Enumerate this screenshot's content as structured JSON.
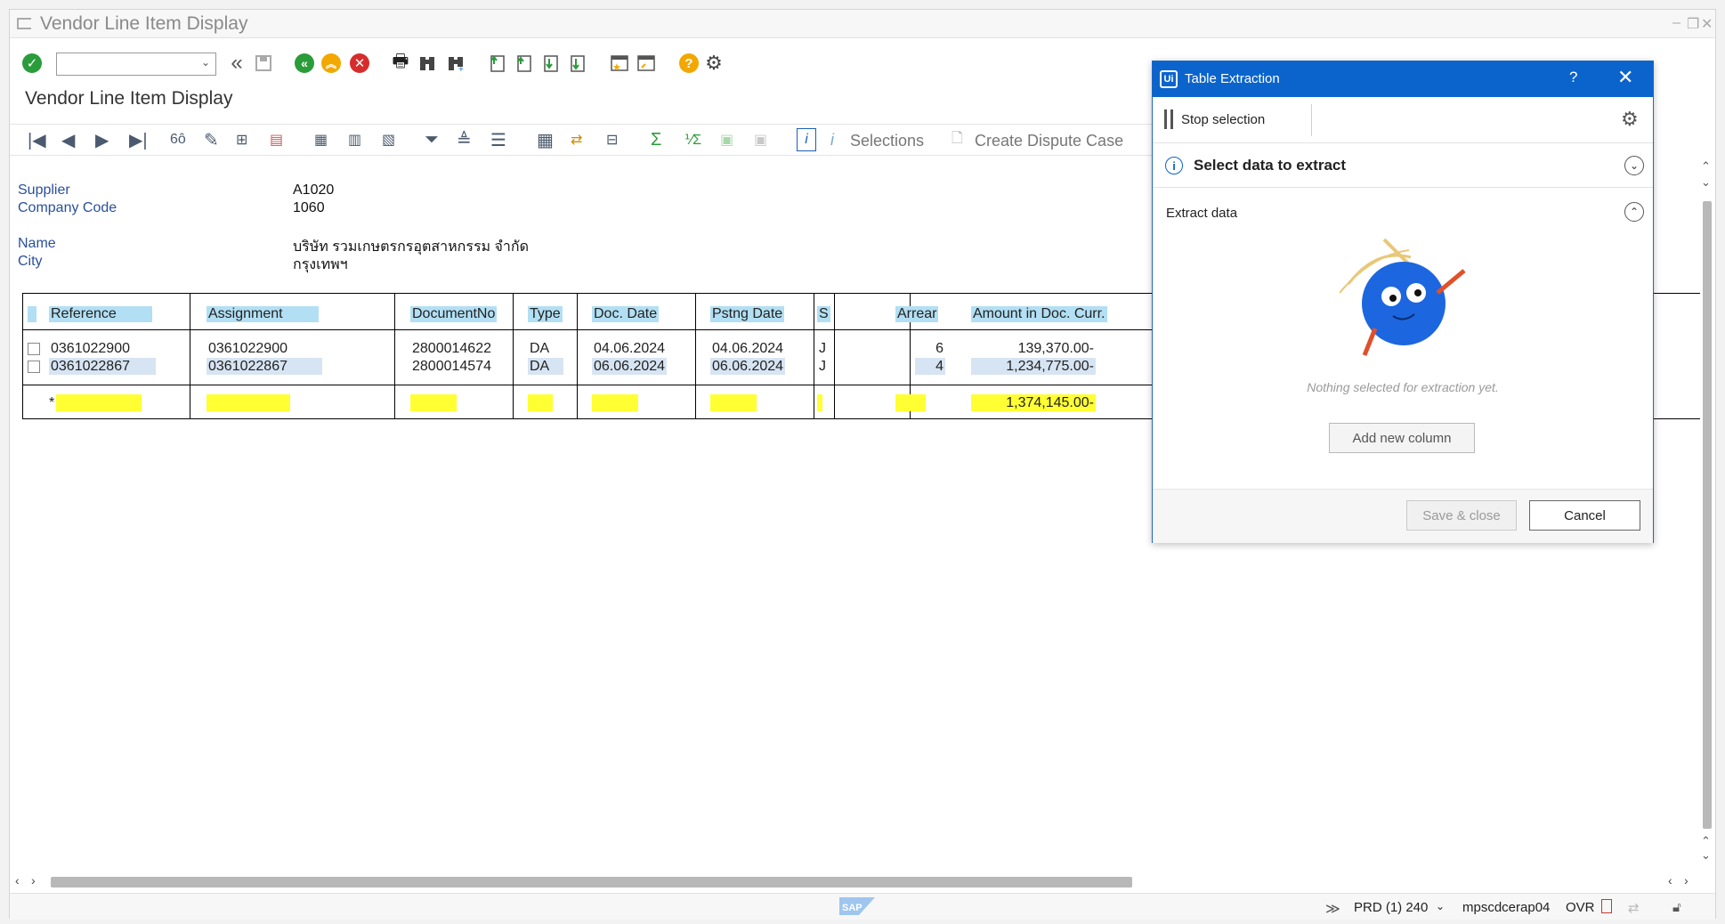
{
  "window": {
    "title": "Vendor Line Item Display"
  },
  "app_title": "Vendor Line Item Display",
  "toolbar2": {
    "selections_label": "Selections",
    "dispute_label": "Create Dispute Case"
  },
  "header_fields": [
    {
      "label": "Supplier",
      "value": "A1020"
    },
    {
      "label": "Company Code",
      "value": "1060"
    },
    {
      "label": "Name",
      "value": "บริษัท รวมเกษตรกรอุตสาหกรรม จำกัด"
    },
    {
      "label": "City",
      "value": "กรุงเทพฯ"
    }
  ],
  "table": {
    "columns": [
      "Reference",
      "Assignment",
      "DocumentNo",
      "Type",
      "Doc. Date",
      "Pstng Date",
      "S",
      "Arrear",
      "Amount in Doc. Curr."
    ],
    "rows": [
      {
        "reference": "0361022900",
        "assignment": "0361022900",
        "document_no": "2800014622",
        "type": "DA",
        "doc_date": "04.06.2024",
        "pstng_date": "04.06.2024",
        "s": "J",
        "arrear": "6",
        "amount": "139,370.00-"
      },
      {
        "reference": "0361022867",
        "assignment": "0361022867",
        "document_no": "2800014574",
        "type": "DA",
        "doc_date": "06.06.2024",
        "pstng_date": "06.06.2024",
        "s": "J",
        "arrear": "4",
        "amount": "1,234,775.00-"
      }
    ],
    "total": {
      "marker": "*",
      "amount": "1,374,145.00-"
    }
  },
  "status_bar": {
    "system": "PRD (1) 240",
    "server": "mpscdcerap04",
    "mode": "OVR"
  },
  "table_extraction": {
    "title": "Table Extraction",
    "help": "?",
    "stop_selection_label": "Stop selection",
    "select_data_label": "Select data to extract",
    "extract_data_label": "Extract data",
    "empty_message": "Nothing selected for extraction yet.",
    "add_column_label": "Add new column",
    "save_close_label": "Save & close",
    "cancel_label": "Cancel"
  },
  "colors": {
    "sap_link": "#2a4f9c",
    "column_header_bg": "#b2dff3",
    "total_bg": "#ffff33",
    "panel_accent": "#0b64cc"
  }
}
